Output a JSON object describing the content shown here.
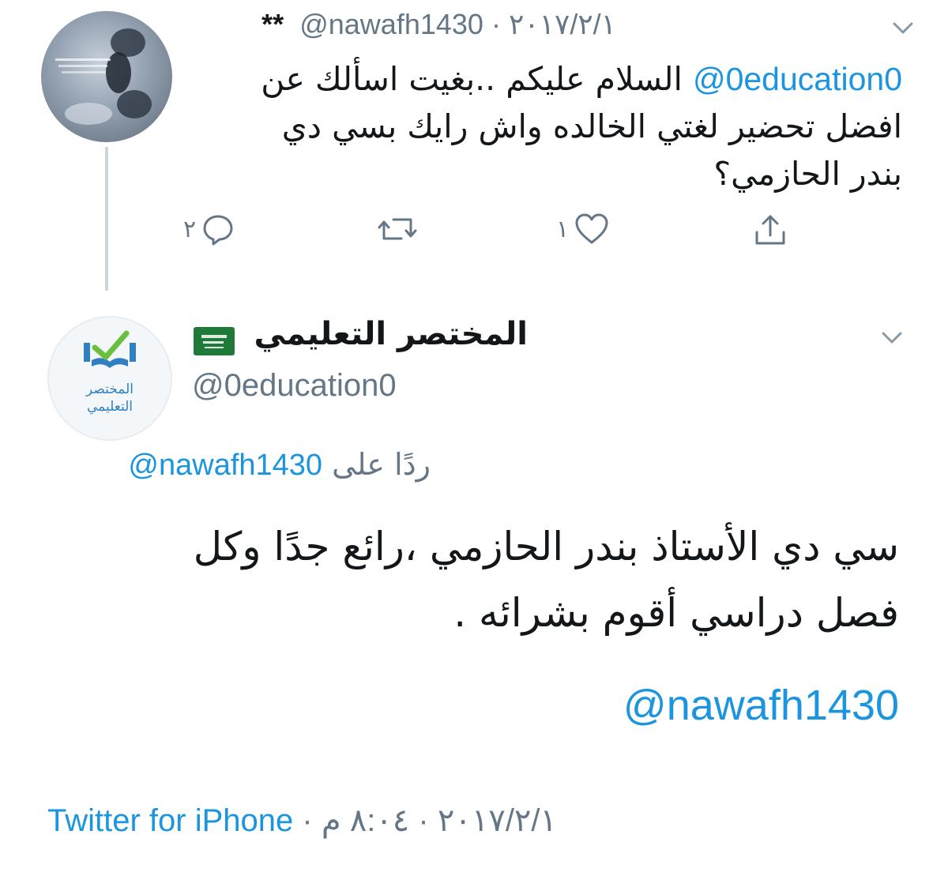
{
  "tweet1": {
    "stars": "**",
    "handle": "@nawafh1430",
    "separator": "·",
    "date": "٢٠١٧/٢/١",
    "mention": "@0education0",
    "text_part1": " السلام عليكم ..بغيت اسألك عن",
    "text_part2": "افضل تحضير لغتي الخالده واش رايك بسي دي",
    "text_part3": "بندر الحازمي؟",
    "reply_count": "٢",
    "like_count": "١"
  },
  "tweet2": {
    "name": "المختصر التعليمي",
    "handle": "@0education0",
    "replying_prefix": "ردًا على",
    "replying_to": "@nawafh1430",
    "text_line1": "سي دي الأستاذ بندر الحازمي ،رائع جدًا وكل",
    "text_line2": "فصل دراسي أقوم بشرائه .",
    "mention": "@nawafh1430",
    "source": "Twitter for iPhone",
    "separator": "·",
    "date": "٢٠١٧/٢/١",
    "time": "٨:٠٤ م"
  },
  "avatar_logo": {
    "text_line1": "المختصر",
    "text_line2": "التعليمي"
  },
  "colors": {
    "link": "#1b95e0",
    "muted": "#657786",
    "thread_line": "#ccd6dd",
    "logo_green": "#6abf3f",
    "logo_blue": "#2f7fc1"
  },
  "icons": [
    "chevron-down-icon",
    "reply-icon",
    "retweet-icon",
    "like-icon",
    "share-icon",
    "saudi-flag-icon"
  ]
}
